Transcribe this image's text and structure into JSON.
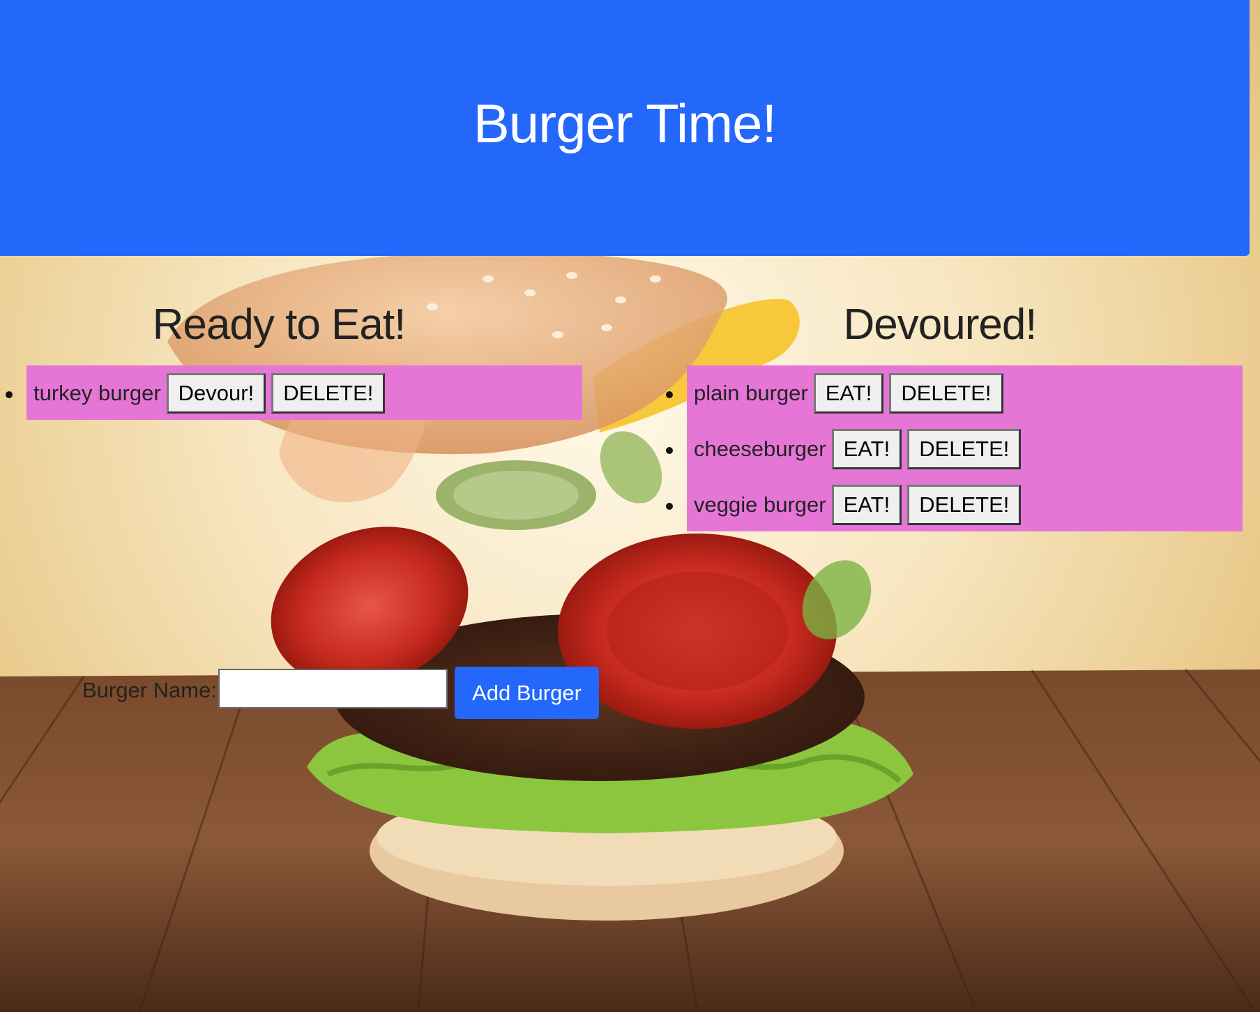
{
  "header": {
    "title": "Burger Time!"
  },
  "ready": {
    "heading": "Ready to Eat!",
    "items": [
      {
        "name": "turkey burger",
        "action_label": "Devour!",
        "delete_label": "DELETE!"
      }
    ]
  },
  "devoured": {
    "heading": "Devoured!",
    "items": [
      {
        "name": "plain burger",
        "action_label": "EAT!",
        "delete_label": "DELETE!"
      },
      {
        "name": "cheeseburger",
        "action_label": "EAT!",
        "delete_label": "DELETE!"
      },
      {
        "name": "veggie burger",
        "action_label": "EAT!",
        "delete_label": "DELETE!"
      }
    ]
  },
  "form": {
    "label": "Burger Name:",
    "input_value": "",
    "submit_label": "Add Burger"
  },
  "colors": {
    "header_bg": "#2468fb",
    "list_bg": "#e676d6",
    "button_primary": "#2468fb"
  }
}
